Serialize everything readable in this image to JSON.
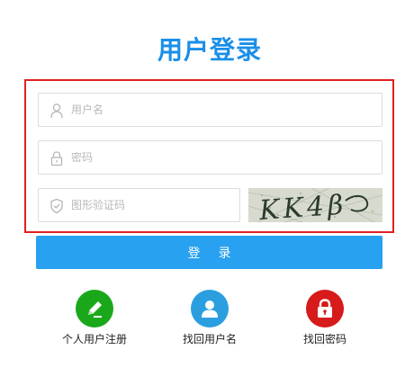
{
  "page": {
    "title": "用户登录"
  },
  "form": {
    "username_placeholder": "用户名",
    "password_placeholder": "密码",
    "captcha_placeholder": "图形验证码",
    "captcha_text": "KK4β",
    "login_label": "登录"
  },
  "shortcuts": [
    {
      "label": "个人用户注册",
      "icon": "pencil-icon",
      "color": "#1aa81a"
    },
    {
      "label": "找回用户名",
      "icon": "user-icon",
      "color": "#2b9ee0"
    },
    {
      "label": "找回密码",
      "icon": "lock-icon",
      "color": "#d71a1a"
    }
  ],
  "colors": {
    "brand": "#1a8fe8",
    "button": "#27a1f0",
    "highlight_border": "#e02020"
  }
}
